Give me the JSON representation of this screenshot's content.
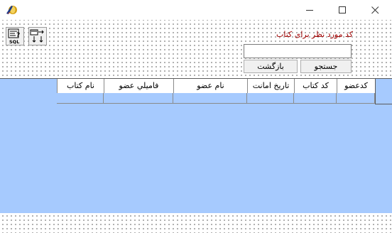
{
  "window": {
    "app_icon": "delphi-app-icon",
    "minimize_symbol": "—",
    "maximize_symbol": "☐",
    "close_symbol": "✕"
  },
  "toolbar": {
    "sql_icon": "sql-query-icon",
    "swap_icon": "swap-transfer-icon"
  },
  "search": {
    "label": "کد مورد نظر برای کتاب",
    "value": "",
    "label_color": "#a00000"
  },
  "buttons": {
    "search_label": "جستجو",
    "back_label": "بازگشت"
  },
  "grid": {
    "background_color": "#a6cafe",
    "columns": [
      "نام کتاب",
      "فامیلي عضو",
      "نام عضو",
      "تاریخ امانت",
      "کد کتاب",
      "کدعضو"
    ]
  }
}
